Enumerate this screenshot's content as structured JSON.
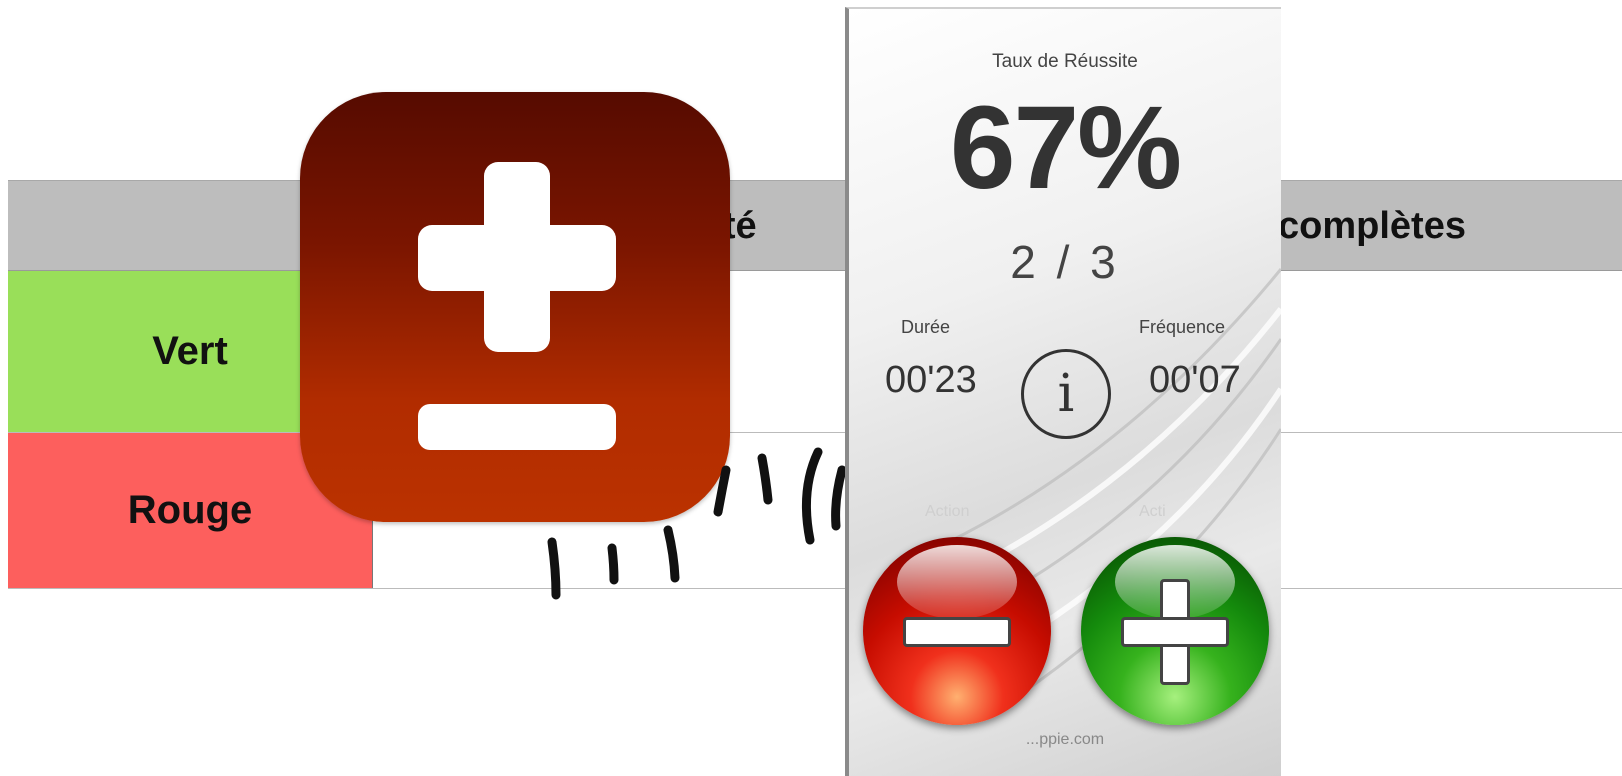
{
  "table": {
    "header": {
      "col2_fragment": "plété",
      "col3_fragment": "complètes"
    },
    "rows": [
      {
        "label": "Vert",
        "color": "#99df59"
      },
      {
        "label": "Rouge",
        "color": "#fd5f5d"
      }
    ]
  },
  "app_icon": {
    "icon": "plus-minus-icon",
    "accent": "#b12c00"
  },
  "phone": {
    "success_label": "Taux de Réussite",
    "success_percent": "67%",
    "success_ratio": "2 / 3",
    "duration_label": "Durée",
    "duration_value": "00'23",
    "frequency_label": "Fréquence",
    "frequency_value": "00'07",
    "info_icon": "info-icon",
    "info_glyph": "i",
    "action_left_label": "Action",
    "action_right_label": "Acti",
    "minus_button_icon": "minus-icon",
    "plus_button_icon": "plus-icon",
    "footer": "...ppie.com",
    "colors": {
      "minus_orb": "#c60c00",
      "plus_orb": "#148a0c"
    }
  }
}
